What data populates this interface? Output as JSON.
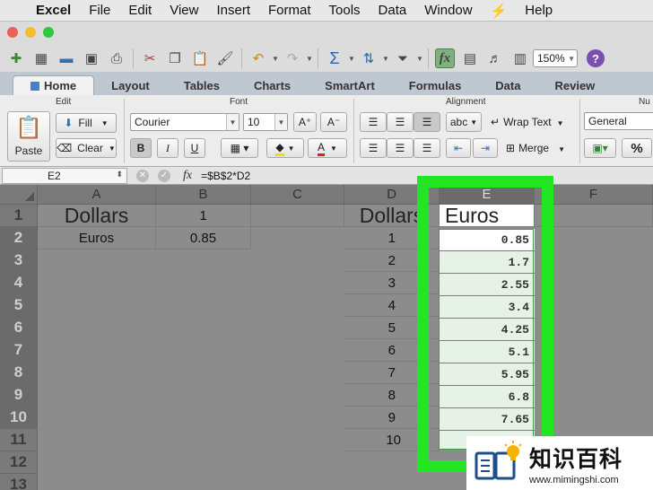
{
  "menubar": {
    "app_name": "Excel",
    "items": [
      "File",
      "Edit",
      "View",
      "Insert",
      "Format",
      "Tools",
      "Data",
      "Window",
      "Help"
    ]
  },
  "toolbar": {
    "zoom_value": "150%",
    "traffic_colors": [
      "#ee5f57",
      "#f3bd2f",
      "#2fc843"
    ]
  },
  "ribbon_tabs": [
    "Home",
    "Layout",
    "Tables",
    "Charts",
    "SmartArt",
    "Formulas",
    "Data",
    "Review"
  ],
  "ribbon": {
    "edit_group": "Edit",
    "paste_label": "Paste",
    "fill_label": "Fill",
    "clear_label": "Clear",
    "font_group": "Font",
    "font_name": "Courier",
    "font_size": "10",
    "bold": "B",
    "italic": "I",
    "underline": "U",
    "alignment_group": "Alignment",
    "wrap_text": "Wrap Text",
    "merge": "Merge",
    "abc": "abc",
    "number_group": "Nu",
    "number_format": "General",
    "percent": "%"
  },
  "formula_bar": {
    "cell_ref": "E2",
    "formula": "=$B$2*D2",
    "fx": "fx"
  },
  "grid": {
    "columns": [
      "A",
      "B",
      "C",
      "D",
      "E",
      "F"
    ],
    "rows": [
      "1",
      "2",
      "3",
      "4",
      "5",
      "6",
      "7",
      "8",
      "9",
      "10",
      "11",
      "12",
      "13"
    ],
    "a1": "Dollars",
    "b1": "1",
    "a2": "Euros",
    "b2": "0.85",
    "d1": "Dollars",
    "e1": "Euros",
    "d_values": [
      "1",
      "2",
      "3",
      "4",
      "5",
      "6",
      "7",
      "8",
      "9",
      "10"
    ],
    "e_values": [
      "0.85",
      "1.7",
      "2.55",
      "3.4",
      "4.25",
      "5.1",
      "5.95",
      "6.8",
      "7.65"
    ]
  },
  "watermark": {
    "title": "知识百科",
    "url": "www.mimingshi.com"
  },
  "colors": {
    "highlight": "#22e622"
  }
}
